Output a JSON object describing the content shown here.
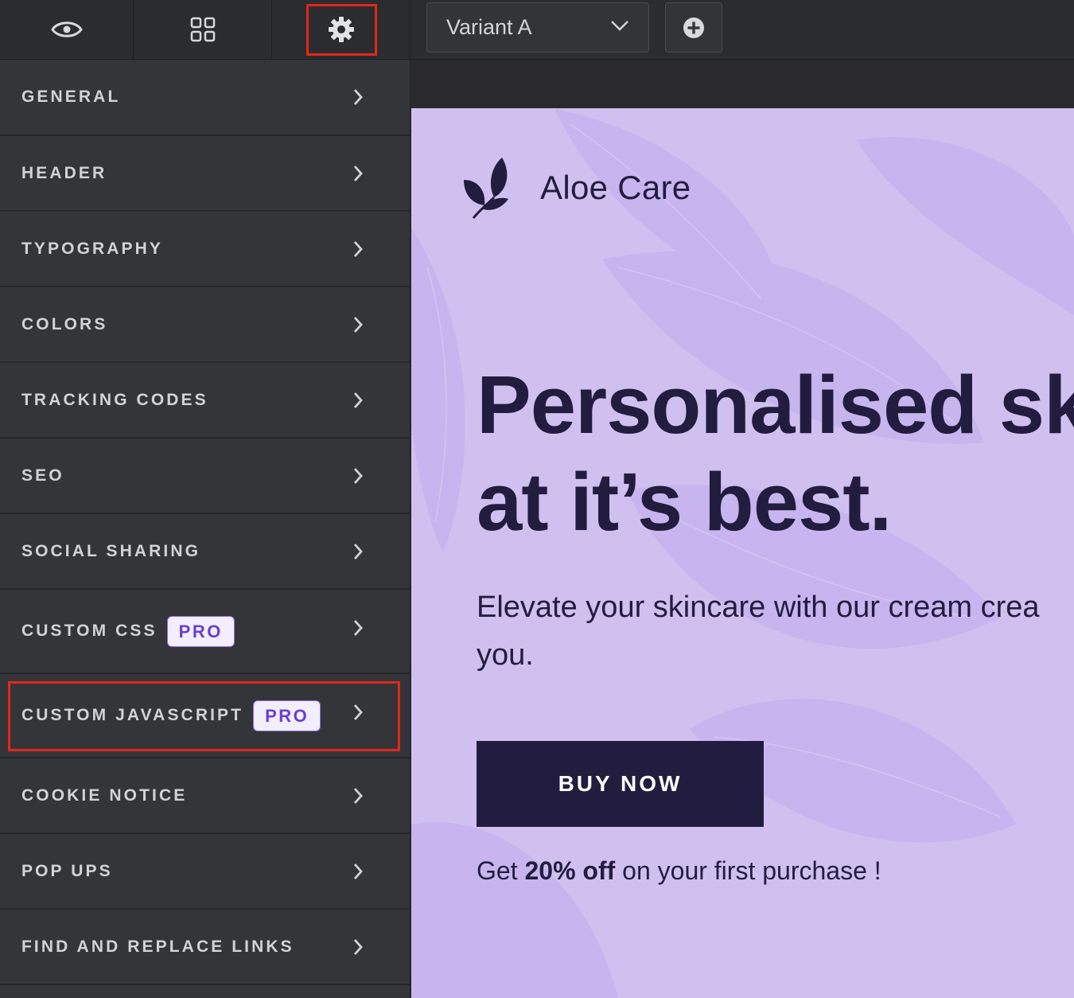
{
  "toolbar": {
    "tabs": [
      {
        "icon": "eye-icon"
      },
      {
        "icon": "grid-icon"
      },
      {
        "icon": "gear-icon",
        "active": true
      }
    ],
    "variant_select": {
      "value": "Variant A"
    },
    "add_variant_icon": "plus-circle-icon"
  },
  "sidebar": {
    "items": [
      {
        "label": "GENERAL"
      },
      {
        "label": "HEADER"
      },
      {
        "label": "TYPOGRAPHY"
      },
      {
        "label": "COLORS"
      },
      {
        "label": "TRACKING CODES"
      },
      {
        "label": "SEO"
      },
      {
        "label": "SOCIAL SHARING"
      },
      {
        "label": "CUSTOM CSS",
        "badge": "PRO"
      },
      {
        "label": "CUSTOM JAVASCRIPT",
        "badge": "PRO",
        "highlighted": true
      },
      {
        "label": "COOKIE NOTICE"
      },
      {
        "label": "POP UPS"
      },
      {
        "label": "FIND AND REPLACE LINKS"
      }
    ]
  },
  "preview": {
    "brand": "Aloe Care",
    "headline_line1": "Personalised sk",
    "headline_line2": "at it’s best.",
    "subcopy_line1": "Elevate your skincare with our cream crea",
    "subcopy_line2": "you.",
    "cta": "BUY NOW",
    "promo_before": "Get ",
    "promo_bold": "20% off",
    "promo_after": " on your first purchase !"
  },
  "colors": {
    "sidebar_bg": "#343538",
    "toolbar_bg": "#2b2c2f",
    "highlight": "#e3261b",
    "preview_bg": "#d0c0f0",
    "brand_dark": "#221d3f",
    "pro_text": "#6a3fd0"
  }
}
